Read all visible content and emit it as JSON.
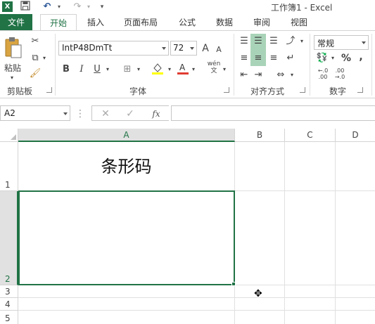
{
  "window": {
    "title": "工作簿1 - Excel",
    "app_icon": "X",
    "accent": "#217346"
  },
  "quick_access": {
    "save_icon": "💾",
    "undo_icon": "↶",
    "redo_icon": "↷",
    "customize_icon": "▾"
  },
  "tabs": {
    "file": "文件",
    "home": "开始",
    "insert": "插入",
    "page_layout": "页面布局",
    "formulas": "公式",
    "data": "数据",
    "review": "审阅",
    "view": "视图"
  },
  "ribbon": {
    "clipboard": {
      "label": "剪贴板",
      "paste": "粘贴"
    },
    "font": {
      "label": "字体",
      "name": "IntP48DmTt",
      "size": "72",
      "bold": "B",
      "italic": "I",
      "underline": "U",
      "grow": "A",
      "shrink": "A",
      "phonetic_top": "wén",
      "phonetic_bottom": "文"
    },
    "alignment": {
      "label": "对齐方式"
    },
    "number": {
      "label": "数字",
      "format": "常规",
      "percent": "%",
      "comma": ",",
      "inc_top": "←.0",
      "inc_bottom": ".00",
      "dec_top": ".00",
      "dec_bottom": "→.0"
    }
  },
  "formula_bar": {
    "name_box": "A2",
    "cancel": "✕",
    "enter": "✓",
    "fx": "fx",
    "dots": "⋮",
    "value": ""
  },
  "sheet": {
    "columns": [
      "A",
      "B",
      "C",
      "D"
    ],
    "rows": [
      "1",
      "2",
      "3",
      "4",
      "5"
    ],
    "cells": {
      "A1": "条形码"
    },
    "selected_cell": "A2"
  }
}
